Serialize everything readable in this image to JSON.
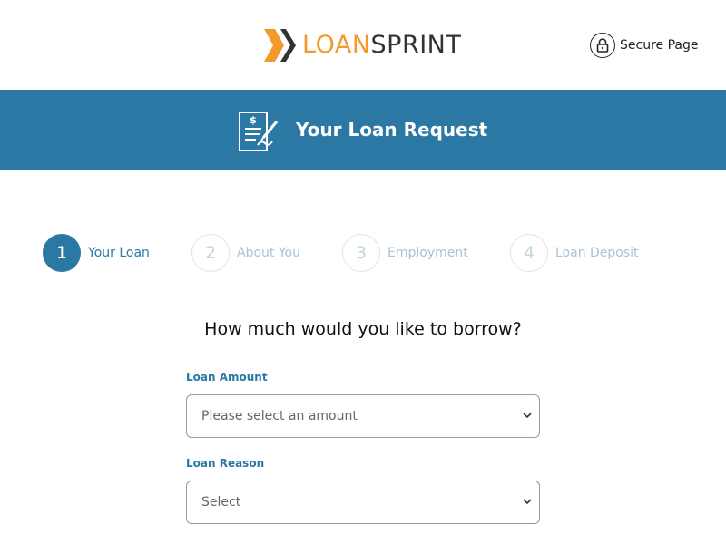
{
  "header": {
    "logo_part1": "LOAN",
    "logo_part2": "SPRINT",
    "secure_label": "Secure Page"
  },
  "banner": {
    "title": "Your Loan Request",
    "icon": "loan-document-icon"
  },
  "steps": [
    {
      "number": "1",
      "label": "Your Loan",
      "active": true
    },
    {
      "number": "2",
      "label": "About You",
      "active": false
    },
    {
      "number": "3",
      "label": "Employment",
      "active": false
    },
    {
      "number": "4",
      "label": "Loan Deposit",
      "active": false
    }
  ],
  "form": {
    "question": "How much would you like to borrow?",
    "loan_amount": {
      "label": "Loan Amount",
      "selected": "Please select an amount"
    },
    "loan_reason": {
      "label": "Loan Reason",
      "selected": "Select"
    }
  },
  "colors": {
    "brand_blue": "#2c78a4",
    "brand_orange": "#f29a2e",
    "inactive_step": "#a9c3d5"
  }
}
